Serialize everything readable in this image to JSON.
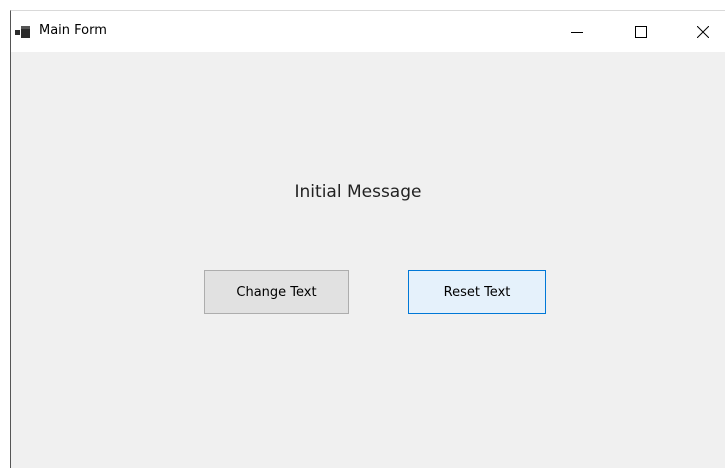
{
  "window": {
    "title": "Main Form",
    "icon": "winforms-app-icon"
  },
  "caption_buttons": {
    "minimize_icon": "minimize-icon",
    "maximize_icon": "maximize-icon",
    "close_icon": "close-icon"
  },
  "form": {
    "message": "Initial Message",
    "change_button_label": "Change Text",
    "reset_button_label": "Reset Text"
  },
  "colors": {
    "form_background": "#f0f0f0",
    "button_background": "#e1e1e1",
    "focused_button_border": "#0078d7",
    "focused_button_background": "#e5f1fb"
  }
}
